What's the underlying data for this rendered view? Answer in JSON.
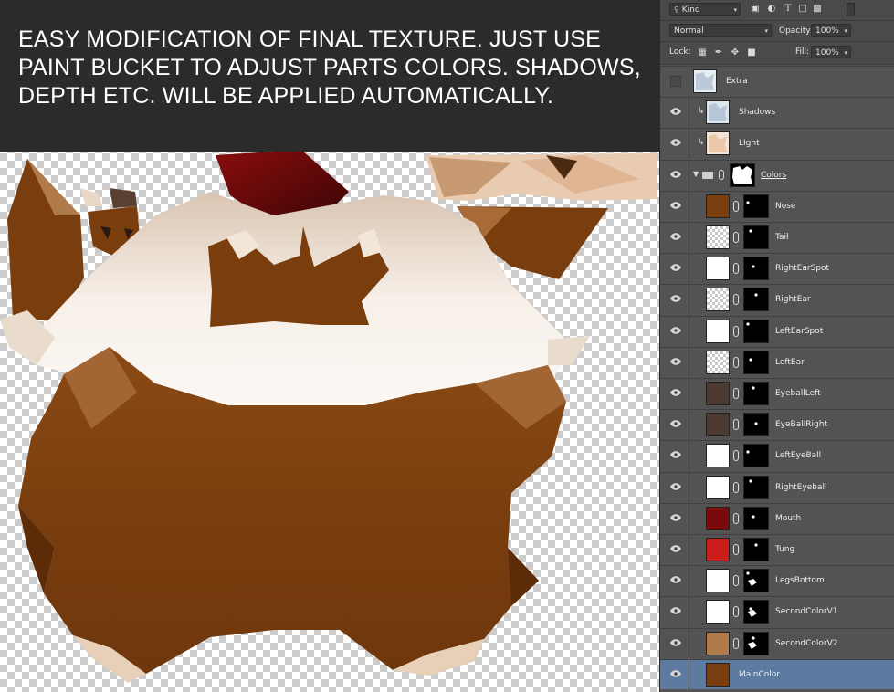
{
  "caption": {
    "line1": "EASY MODIFICATION OF FINAL TEXTURE. JUST USE",
    "line2": "PAINT BUCKET TO ADJUST PARTS COLORS. SHADOWS,",
    "line3": "DEPTH ETC. WILL BE APPLIED AUTOMATICALLY."
  },
  "panel": {
    "filter_label": "Kind",
    "blend_mode": "Normal",
    "opacity_label": "Opacity:",
    "opacity_value": "100%",
    "lock_label": "Lock:",
    "fill_label": "Fill:",
    "fill_value": "100%",
    "filter_icons": [
      "image-filter-icon",
      "adjustment-filter-icon",
      "type-filter-icon",
      "shape-filter-icon",
      "smart-object-filter-icon",
      "toggle-filter-icon"
    ],
    "lock_icons": [
      "lock-pixels-icon",
      "lock-paint-icon",
      "lock-position-icon",
      "lock-all-icon"
    ]
  },
  "layers": [
    {
      "name": "Extra",
      "visible": false,
      "kind": "image",
      "thumb": "#e8eef2"
    },
    {
      "name": "Shadows",
      "visible": true,
      "kind": "clipped",
      "thumb": "#dce6ef"
    },
    {
      "name": "LIght",
      "visible": true,
      "kind": "clipped",
      "thumb": "#f3e6d8"
    },
    {
      "name": "Colors",
      "visible": true,
      "kind": "group",
      "thumb": "#000000"
    },
    {
      "name": "Nose",
      "visible": true,
      "kind": "fill",
      "thumb": "#7a3e0e"
    },
    {
      "name": "Tail",
      "visible": true,
      "kind": "fill",
      "thumb": "checker"
    },
    {
      "name": "RightEarSpot",
      "visible": true,
      "kind": "fill",
      "thumb": "#ffffff"
    },
    {
      "name": "RightEar",
      "visible": true,
      "kind": "fill",
      "thumb": "checker"
    },
    {
      "name": "LeftEarSpot",
      "visible": true,
      "kind": "fill",
      "thumb": "#ffffff"
    },
    {
      "name": "LeftEar",
      "visible": true,
      "kind": "fill",
      "thumb": "checker"
    },
    {
      "name": "EyeballLeft",
      "visible": true,
      "kind": "fill",
      "thumb": "#4a3a32"
    },
    {
      "name": "EyeBallRight",
      "visible": true,
      "kind": "fill",
      "thumb": "#4a3a32"
    },
    {
      "name": "LeftEyeBall",
      "visible": true,
      "kind": "fill",
      "thumb": "#ffffff"
    },
    {
      "name": "RightEyeball",
      "visible": true,
      "kind": "fill",
      "thumb": "#ffffff"
    },
    {
      "name": "Mouth",
      "visible": true,
      "kind": "fill",
      "thumb": "#7b0a0a"
    },
    {
      "name": "Tung",
      "visible": true,
      "kind": "fill",
      "thumb": "#cc1c1c"
    },
    {
      "name": "LegsBottom",
      "visible": true,
      "kind": "fill",
      "thumb": "#ffffff"
    },
    {
      "name": "SecondColorV1",
      "visible": true,
      "kind": "fill",
      "thumb": "#ffffff"
    },
    {
      "name": "SecondColorV2",
      "visible": true,
      "kind": "fill",
      "thumb": "#b07a4a"
    },
    {
      "name": "MainColor",
      "visible": true,
      "kind": "base",
      "thumb": "#7a3e0e",
      "selected": true
    }
  ],
  "colors": {
    "main_brown": "#7a3e0e",
    "light_brown": "#b07a4a",
    "cream": "#f5ede4",
    "dark_red": "#6a0a0a",
    "panel_bg": "#535353",
    "selection": "#5d7aa1"
  }
}
